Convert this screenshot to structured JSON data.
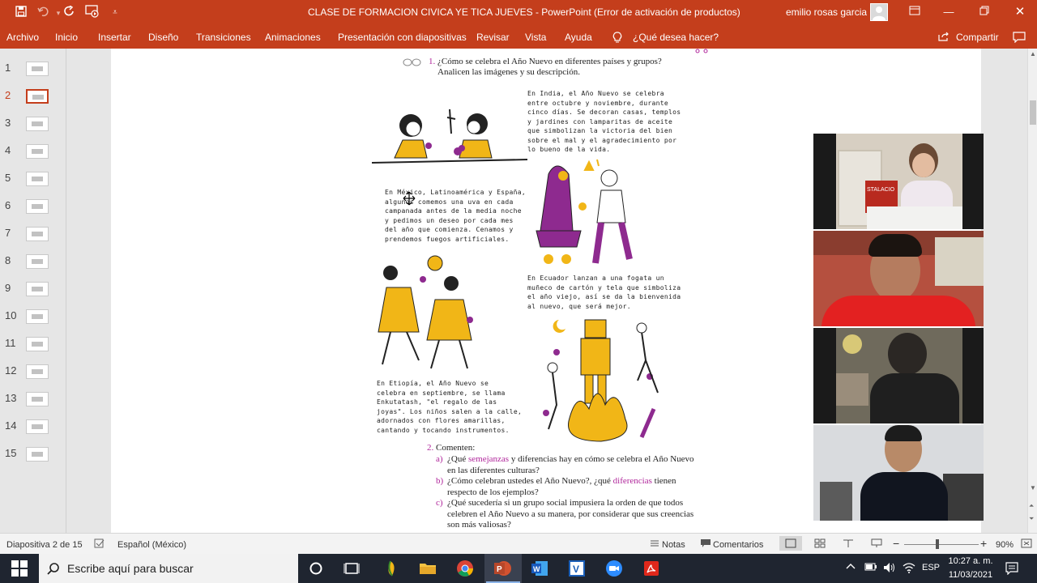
{
  "titlebar": {
    "title": "CLASE DE FORMACION CIVICA YE TICA JUEVES  -  PowerPoint (Error de activación de productos)",
    "user": "emilio rosas garcia",
    "quick_access": [
      "save-icon",
      "undo-icon",
      "redo-icon",
      "start-from-beginning-icon",
      "customize-icon"
    ]
  },
  "menu": {
    "items": [
      "Archivo",
      "Inicio",
      "Insertar",
      "Diseño",
      "Transiciones",
      "Animaciones",
      "Presentación con diapositivas",
      "Revisar",
      "Vista",
      "Ayuda"
    ],
    "tell_me": "¿Qué desea hacer?",
    "share": "Compartir"
  },
  "thumbnails": {
    "numbers": [
      "1",
      "2",
      "3",
      "4",
      "5",
      "6",
      "7",
      "8",
      "9",
      "10",
      "11",
      "12",
      "13",
      "14",
      "15"
    ],
    "active_index": 2
  },
  "slide": {
    "q1_num": "1.",
    "q1_line1": "¿Cómo se celebra el Año Nuevo en diferentes países y grupos?",
    "q1_line2": "Analicen las imágenes y su descripción.",
    "india": "En India, el Año Nuevo se celebra\nentre octubre y noviembre, durante\ncinco días. Se decoran casas, templos\ny jardines con lamparitas de aceite\nque simbolizan la victoria del bien\nsobre el mal y el agradecimiento por\nlo bueno de la vida.",
    "mexico": "En México, Latinoamérica y España,\nalgunos comemos una uva en cada\ncampanada antes de la media noche\ny pedimos un deseo por cada mes\ndel año que comienza. Cenamos y\nprendemos fuegos artificiales.",
    "ecuador": "En Ecuador lanzan a una fogata un\nmuñeco de cartón y tela que simboliza\nel año viejo, así se da la bienvenida\nal nuevo, que será mejor.",
    "etiopia": "En Etiopía, el Año Nuevo se\ncelebra en septiembre, se llama\nEnkutatash, \"el regalo de las\njoyas\". Los niños salen a la calle,\nadornados con flores amarillas,\ncantando y tocando instrumentos.",
    "q2_num": "2.",
    "q2_title": "Comenten:",
    "qa_letter": "a)",
    "qa_pre": "¿Qué ",
    "qa_hl1": "semejanzas",
    "qa_mid": " y diferencias hay en cómo se celebra el Año Nuevo",
    "qa_line2": "en las diferentes culturas?",
    "qb_letter": "b)",
    "qb_pre": "¿Cómo celebran ustedes el Año Nuevo?, ¿qué ",
    "qb_hl": "diferencias",
    "qb_post": " tienen",
    "qb_line2": "respecto de los ejemplos?",
    "qc_letter": "c)",
    "qc_line1": "¿Qué sucedería si un grupo social impusiera la orden de que todos",
    "qc_line2": "celebren el Año Nuevo a su manera, por considerar que sus creencias",
    "qc_line3": "son más valiosas?",
    "sticker1": "STALACIO",
    "colors": {
      "accent": "#c43e1c",
      "illustration_yellow": "#f1b617",
      "illustration_purple": "#8e2a8f"
    }
  },
  "status": {
    "slide_info": "Diapositiva 2 de 15",
    "language": "Español (México)",
    "notes": "Notas",
    "comments": "Comentarios",
    "zoom": "90%",
    "zoom_percent": 90
  },
  "taskbar": {
    "search_placeholder": "Escribe aquí para buscar",
    "lang": "ESP",
    "time": "10:27 a. m.",
    "date": "11/03/2021"
  }
}
